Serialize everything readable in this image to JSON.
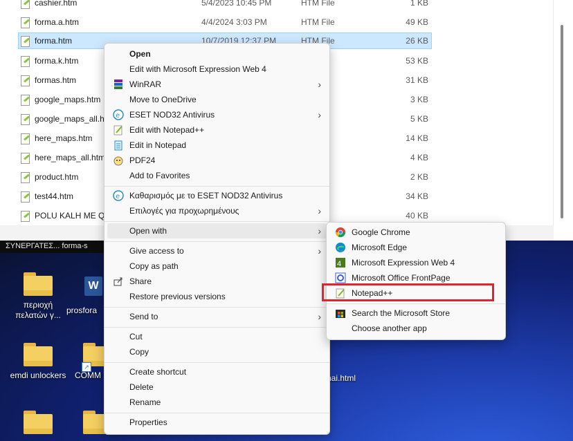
{
  "files": [
    {
      "name": "cashier.htm",
      "date": "5/4/2023 10:45 PM",
      "type": "HTM File",
      "size": "1 KB"
    },
    {
      "name": "forma.a.htm",
      "date": "4/4/2024 3:03 PM",
      "type": "HTM File",
      "size": "49 KB"
    },
    {
      "name": "forma.htm",
      "date": "10/7/2019 12:37 PM",
      "type": "HTM File",
      "size": "26 KB"
    },
    {
      "name": "forma.k.htm",
      "date": "",
      "type": "",
      "size": "53 KB"
    },
    {
      "name": "formas.htm",
      "date": "",
      "type": "",
      "size": "31 KB"
    },
    {
      "name": "google_maps.htm",
      "date": "",
      "type": "",
      "size": "3 KB"
    },
    {
      "name": "google_maps_all.htm",
      "date": "",
      "type": "",
      "size": "5 KB"
    },
    {
      "name": "here_maps.htm",
      "date": "",
      "type": "",
      "size": "14 KB"
    },
    {
      "name": "here_maps_all.htm",
      "date": "",
      "type": "",
      "size": "4 KB"
    },
    {
      "name": "product.htm",
      "date": "",
      "type": "",
      "size": "2 KB"
    },
    {
      "name": "test44.htm",
      "date": "",
      "type": "",
      "size": "34 KB"
    },
    {
      "name": "POLU KALH ME QR",
      "date": "",
      "type": "",
      "size": "40 KB"
    }
  ],
  "desktop": {
    "taskbar_text": "ΣΥΝΕΡΓΑΤΕΣ...    forma-s",
    "icons": [
      {
        "label": "περιοχή πελατών γ..."
      },
      {
        "label": "prosfora"
      },
      {
        "label": "emdi unlockers"
      },
      {
        "label": "COMM"
      },
      {
        "label": "nai.html"
      }
    ]
  },
  "context_menu": {
    "items": [
      {
        "label": "Open"
      },
      {
        "label": "Edit with Microsoft Expression Web 4"
      },
      {
        "label": "WinRAR"
      },
      {
        "label": "Move to OneDrive"
      },
      {
        "label": "ESET NOD32 Antivirus"
      },
      {
        "label": "Edit with Notepad++"
      },
      {
        "label": "Edit in Notepad"
      },
      {
        "label": "PDF24"
      },
      {
        "label": "Add to Favorites"
      },
      {
        "label": "Καθαρισμός με το ESET NOD32 Antivirus"
      },
      {
        "label": "Επιλογές για προχωρημένους"
      },
      {
        "label": "Open with"
      },
      {
        "label": "Give access to"
      },
      {
        "label": "Copy as path"
      },
      {
        "label": "Share"
      },
      {
        "label": "Restore previous versions"
      },
      {
        "label": "Send to"
      },
      {
        "label": "Cut"
      },
      {
        "label": "Copy"
      },
      {
        "label": "Create shortcut"
      },
      {
        "label": "Delete"
      },
      {
        "label": "Rename"
      },
      {
        "label": "Properties"
      }
    ]
  },
  "open_with_menu": {
    "items": [
      {
        "label": "Google Chrome"
      },
      {
        "label": "Microsoft Edge"
      },
      {
        "label": "Microsoft Expression Web 4"
      },
      {
        "label": "Microsoft Office FrontPage"
      },
      {
        "label": "Notepad++"
      },
      {
        "label": "Search the Microsoft Store"
      },
      {
        "label": "Choose another app"
      }
    ]
  },
  "colors": {
    "selection": "#cce8ff",
    "highlight_box": "#e0232f",
    "menu_bg": "#f9f9f9"
  }
}
